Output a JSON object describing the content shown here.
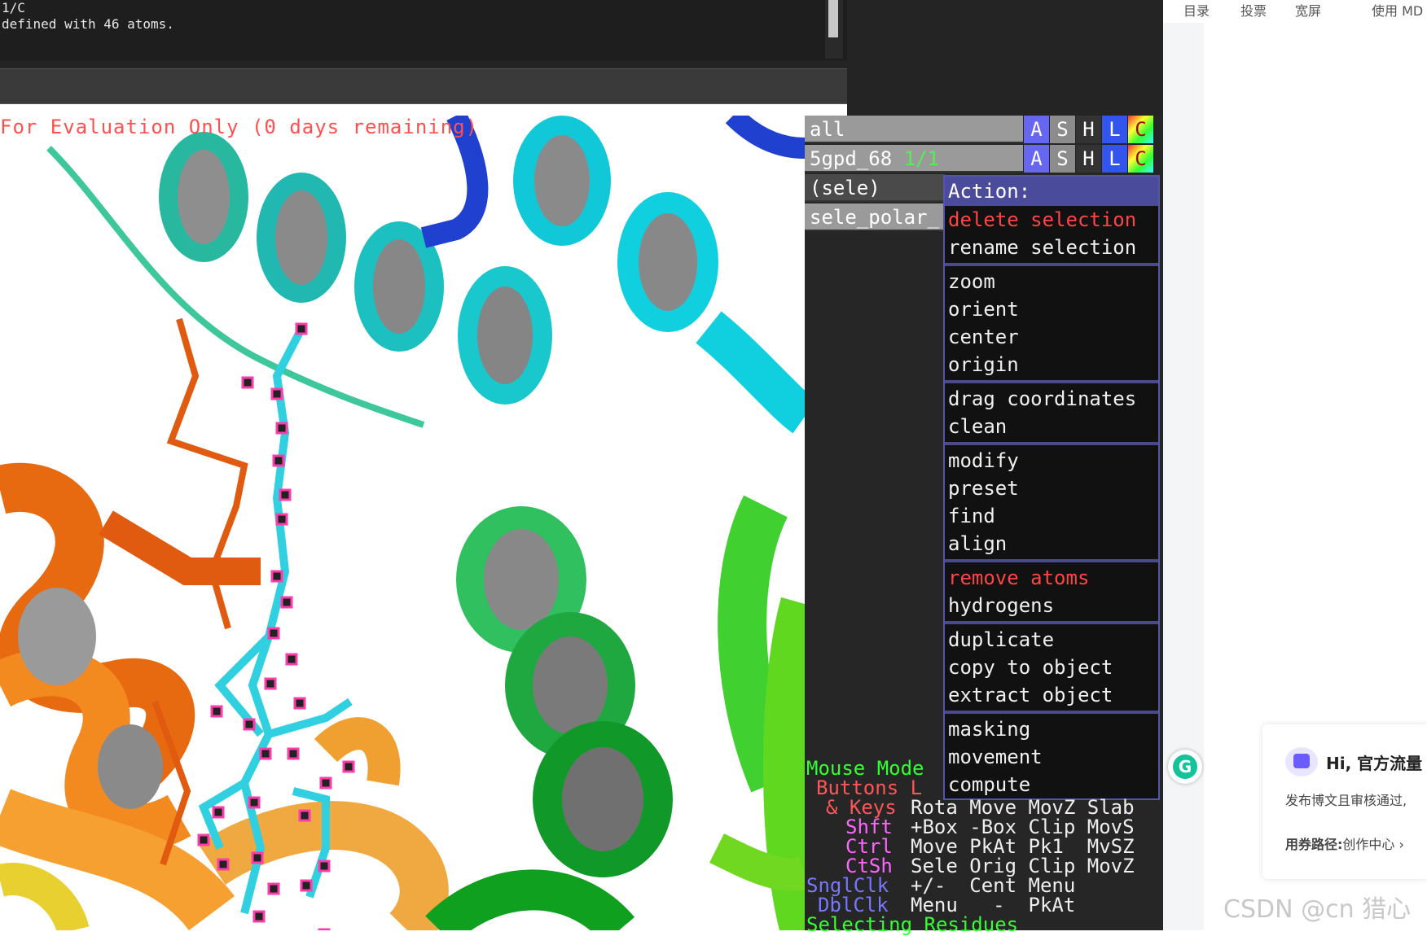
{
  "console": {
    "line1": "1/C",
    "line2": "defined with 46 atoms."
  },
  "viewport": {
    "eval_text": "For Evaluation Only (0 days remaining)"
  },
  "object_panel": {
    "objects": [
      {
        "name": "all",
        "state": ""
      },
      {
        "name": "5gpd_68",
        "state": "1/1"
      },
      {
        "name": "(sele)",
        "state": ""
      },
      {
        "name": "sele_polar_",
        "state": ""
      }
    ],
    "buttons": [
      "A",
      "S",
      "H",
      "L",
      "C"
    ]
  },
  "action_menu": {
    "title": "Action:",
    "groups": [
      [
        "delete selection",
        "rename selection"
      ],
      [
        "zoom",
        "orient",
        "center",
        "origin"
      ],
      [
        "drag coordinates",
        "clean"
      ],
      [
        "modify",
        "preset",
        "find",
        "align"
      ],
      [
        "remove atoms",
        "hydrogens"
      ],
      [
        "duplicate",
        "copy to object",
        "extract object"
      ],
      [
        "masking",
        "movement",
        "compute"
      ]
    ]
  },
  "mouse_mode": {
    "title": "Mouse Mode",
    "buttons_label": "Buttons",
    "buttons_trail": "L",
    "keys_label": "& Keys",
    "keys_row": "Rota Move MovZ Slab",
    "rows": [
      {
        "key": "Shft",
        "actions": "+Box -Box Clip MovS"
      },
      {
        "key": "Ctrl",
        "actions": "Move PkAt Pk1  MvSZ"
      },
      {
        "key": "CtSh",
        "actions": "Sele Orig Clip MovZ"
      },
      {
        "key": "SnglClk",
        "actions": "+/-  Cent Menu"
      },
      {
        "key": "DblClk",
        "actions": "Menu   -  PkAt"
      }
    ],
    "selecting": "Selecting Residues"
  },
  "web": {
    "nav": [
      "目录",
      "投票",
      "宽屏",
      "使用 MD"
    ],
    "card_title": "Hi, 官方流量",
    "card_line": "发布博文且审核通过,",
    "card_path_label": "用券路径:",
    "card_path_value": "创作中心 ›",
    "grammarly": "G",
    "watermark": "CSDN @cn 猎心"
  }
}
